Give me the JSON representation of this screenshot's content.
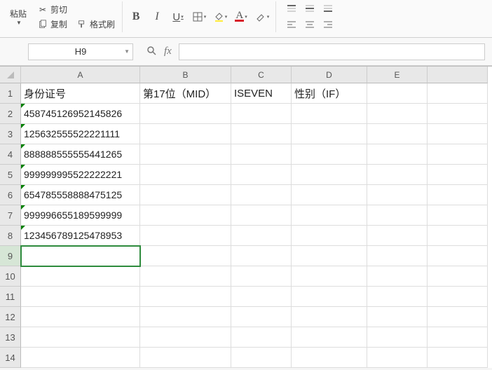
{
  "ribbon": {
    "paste_label": "粘贴",
    "cut_label": "剪切",
    "copy_label": "复制",
    "format_painter_label": "格式刷",
    "bold": "B",
    "italic": "I",
    "underline": "U",
    "font_char": "A"
  },
  "namebox": {
    "value": "H9",
    "fx_label": "fx"
  },
  "columns": [
    "A",
    "B",
    "C",
    "D",
    "E"
  ],
  "headers": {
    "A": "身份证号",
    "B": "第17位（MID）",
    "C": "ISEVEN",
    "D": "性别（IF）",
    "E": ""
  },
  "rows": [
    {
      "n": 1,
      "A": "身份证号",
      "B": "第17位（MID）",
      "C": "ISEVEN",
      "D": "性别（IF）",
      "E": ""
    },
    {
      "n": 2,
      "A": "458745126952145826",
      "B": "",
      "C": "",
      "D": "",
      "E": ""
    },
    {
      "n": 3,
      "A": "125632555522221111",
      "B": "",
      "C": "",
      "D": "",
      "E": ""
    },
    {
      "n": 4,
      "A": "888888555555441265",
      "B": "",
      "C": "",
      "D": "",
      "E": ""
    },
    {
      "n": 5,
      "A": "999999995522222221",
      "B": "",
      "C": "",
      "D": "",
      "E": ""
    },
    {
      "n": 6,
      "A": "654785558888475125",
      "B": "",
      "C": "",
      "D": "",
      "E": ""
    },
    {
      "n": 7,
      "A": "999996655189599999",
      "B": "",
      "C": "",
      "D": "",
      "E": ""
    },
    {
      "n": 8,
      "A": "123456789125478953",
      "B": "",
      "C": "",
      "D": "",
      "E": ""
    },
    {
      "n": 9,
      "A": "",
      "B": "",
      "C": "",
      "D": "",
      "E": ""
    },
    {
      "n": 10,
      "A": "",
      "B": "",
      "C": "",
      "D": "",
      "E": ""
    },
    {
      "n": 11,
      "A": "",
      "B": "",
      "C": "",
      "D": "",
      "E": ""
    },
    {
      "n": 12,
      "A": "",
      "B": "",
      "C": "",
      "D": "",
      "E": ""
    },
    {
      "n": 13,
      "A": "",
      "B": "",
      "C": "",
      "D": "",
      "E": ""
    },
    {
      "n": 14,
      "A": "",
      "B": "",
      "C": "",
      "D": "",
      "E": ""
    }
  ],
  "selected": {
    "row": 9,
    "col": "A_rowhdr_only"
  }
}
